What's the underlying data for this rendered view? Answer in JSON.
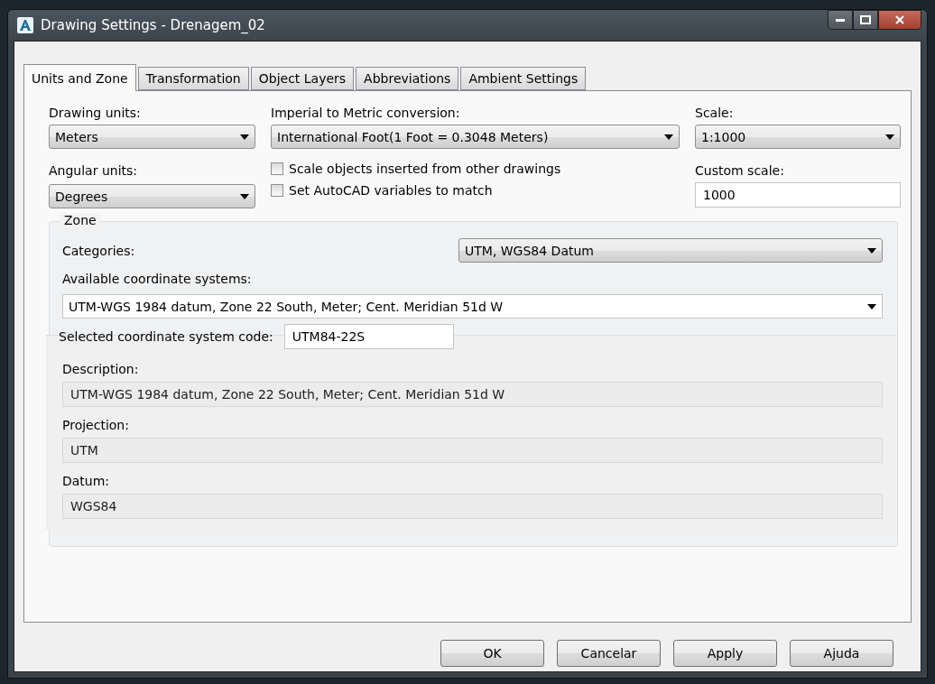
{
  "window": {
    "title": "Drawing Settings - Drenagem_02"
  },
  "tabs": [
    {
      "label": "Units and Zone",
      "selected": true
    },
    {
      "label": "Transformation",
      "selected": false
    },
    {
      "label": "Object Layers",
      "selected": false
    },
    {
      "label": "Abbreviations",
      "selected": false
    },
    {
      "label": "Ambient Settings",
      "selected": false
    }
  ],
  "drawing_units": {
    "label": "Drawing units:",
    "value": "Meters"
  },
  "angular_units": {
    "label": "Angular units:",
    "value": "Degrees"
  },
  "conversion": {
    "label": "Imperial to Metric conversion:",
    "value": "International Foot(1 Foot = 0.3048 Meters)"
  },
  "options": [
    {
      "label": "Scale objects inserted from other drawings",
      "checked": false
    },
    {
      "label": "Set AutoCAD variables to match",
      "checked": false
    }
  ],
  "scale": {
    "label": "Scale:",
    "value": "1:1000"
  },
  "custom_scale": {
    "label": "Custom scale:",
    "value": "1000"
  },
  "zone": {
    "title": "Zone",
    "categories": {
      "label": "Categories:",
      "value": "UTM, WGS84 Datum"
    },
    "available": {
      "label": "Available coordinate systems:",
      "value": "UTM-WGS 1984 datum, Zone 22 South, Meter; Cent. Meridian 51d W"
    },
    "code": {
      "label": "Selected coordinate system code:",
      "value": "UTM84-22S"
    },
    "details": [
      {
        "label": "Description:",
        "value": "UTM-WGS 1984 datum, Zone 22 South, Meter; Cent. Meridian 51d W"
      },
      {
        "label": "Projection:",
        "value": "UTM"
      },
      {
        "label": "Datum:",
        "value": "WGS84"
      }
    ]
  },
  "buttons": [
    {
      "label": "OK"
    },
    {
      "label": "Cancelar"
    },
    {
      "label": "Apply"
    },
    {
      "label": "Ajuda"
    }
  ]
}
